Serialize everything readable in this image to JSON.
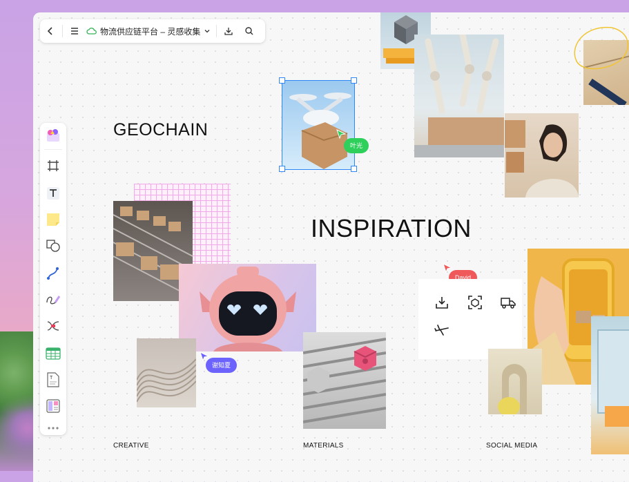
{
  "topbar": {
    "back_icon": "chevron-left-icon",
    "menu_icon": "menu-icon",
    "cloud_icon": "cloud-icon",
    "doc_title": "物流供应链平台 – 灵感收集",
    "download_icon": "download-icon",
    "search_icon": "search-icon"
  },
  "toolbar": {
    "tools": [
      "app-logo-icon",
      "frame-icon",
      "text-icon",
      "sticky-note-icon",
      "shape-icon",
      "connector-icon",
      "pen-icon",
      "mindmap-icon",
      "table-icon",
      "doc-icon",
      "template-icon",
      "more-icon"
    ]
  },
  "board": {
    "heading_geochain": "GEOCHAIN",
    "heading_inspiration": "INSPIRATION",
    "captions": {
      "creative": "CREATIVE",
      "materials": "MATERIALS",
      "social": "SOCIAL MEDIA"
    },
    "cursors": [
      {
        "name": "叶光",
        "color": "#2ecf5a"
      },
      {
        "name": "David",
        "color": "#f0595a"
      },
      {
        "name": "谢知夏",
        "color": "#6c63ff"
      }
    ],
    "panel_icons": [
      "download-tray-icon",
      "scan-box-icon",
      "truck-icon",
      "airplane-icon"
    ]
  },
  "colors": {
    "selection": "#2f86f6",
    "accent_pink": "#f2a7e6",
    "yellow_bg": "#f1b64a"
  }
}
